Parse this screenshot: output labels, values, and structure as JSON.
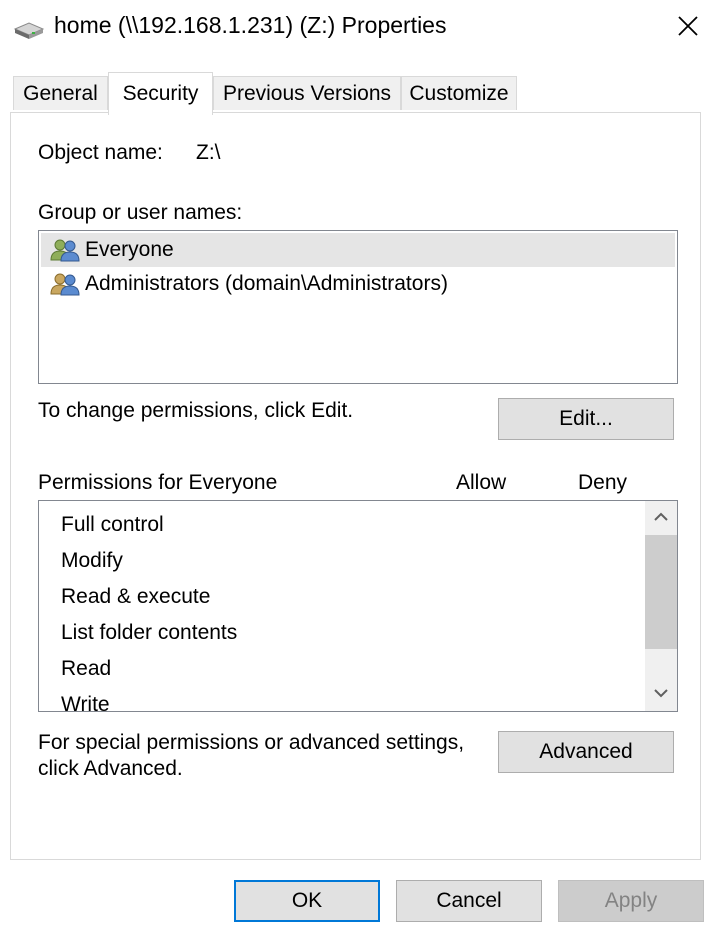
{
  "window": {
    "title": "home (\\\\192.168.1.231) (Z:) Properties",
    "drive_icon": "network-drive-icon",
    "close_icon": "close-icon"
  },
  "tabs": [
    {
      "label": "General",
      "active": false
    },
    {
      "label": "Security",
      "active": true
    },
    {
      "label": "Previous Versions",
      "active": false
    },
    {
      "label": "Customize",
      "active": false
    }
  ],
  "security": {
    "object_name_label": "Object name:",
    "object_name_value": "Z:\\",
    "group_label": "Group or user names:",
    "users": [
      {
        "name": "Everyone",
        "icon": "users-icon",
        "selected": true
      },
      {
        "name": "Administrators (domain\\Administrators)",
        "icon": "users-icon",
        "selected": false
      }
    ],
    "change_hint": "To change permissions, click Edit.",
    "edit_label": "Edit...",
    "permissions_label": "Permissions for Everyone",
    "allow_header": "Allow",
    "deny_header": "Deny",
    "permissions": [
      "Full control",
      "Modify",
      "Read & execute",
      "List folder contents",
      "Read",
      "Write"
    ],
    "special_hint_line1": "For special permissions or advanced settings,",
    "special_hint_line2": "click Advanced.",
    "advanced_label": "Advanced"
  },
  "footer": {
    "ok_label": "OK",
    "cancel_label": "Cancel",
    "apply_label": "Apply",
    "apply_enabled": false
  },
  "colors": {
    "selected_row": "#e5e5e5",
    "focus_border": "#0078d7",
    "disabled_text": "#838383"
  }
}
